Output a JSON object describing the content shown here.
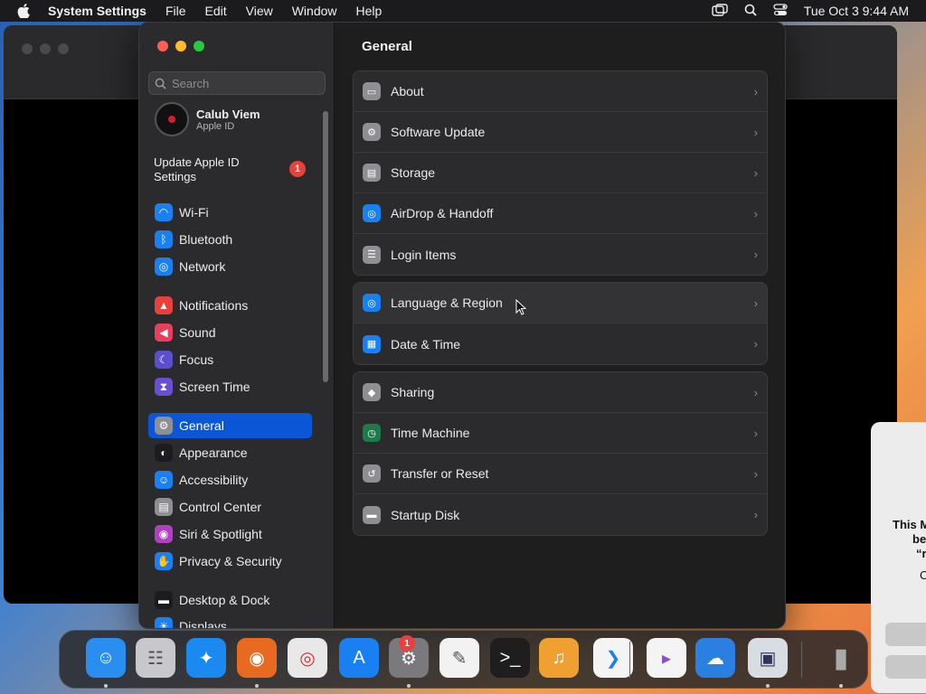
{
  "menubar": {
    "app_name": "System Settings",
    "menus": [
      "File",
      "Edit",
      "View",
      "Window",
      "Help"
    ],
    "datetime": "Tue Oct 3  9:44 AM"
  },
  "sidebar": {
    "search_placeholder": "Search",
    "profile": {
      "name": "Calub Viem",
      "subtitle": "Apple ID"
    },
    "update": {
      "label": "Update Apple ID Settings",
      "badge": "1"
    },
    "items": [
      {
        "label": "Wi-Fi",
        "icon": "wifi-icon",
        "color": "#1a7ff0"
      },
      {
        "label": "Bluetooth",
        "icon": "bluetooth-icon",
        "color": "#1a7ff0"
      },
      {
        "label": "Network",
        "icon": "globe-icon",
        "color": "#1a7ff0"
      },
      {
        "label": "Notifications",
        "icon": "bell-icon",
        "color": "#e8403a"
      },
      {
        "label": "Sound",
        "icon": "speaker-icon",
        "color": "#e8405a"
      },
      {
        "label": "Focus",
        "icon": "moon-icon",
        "color": "#5b4fd0"
      },
      {
        "label": "Screen Time",
        "icon": "hourglass-icon",
        "color": "#6a4fd0"
      },
      {
        "label": "General",
        "icon": "gear-icon",
        "color": "#8e8e93"
      },
      {
        "label": "Appearance",
        "icon": "appearance-icon",
        "color": "#1c1c1e"
      },
      {
        "label": "Accessibility",
        "icon": "accessibility-icon",
        "color": "#1a7ff0"
      },
      {
        "label": "Control Center",
        "icon": "control-center-icon",
        "color": "#8e8e93"
      },
      {
        "label": "Siri & Spotlight",
        "icon": "siri-icon",
        "color": "#b040c0"
      },
      {
        "label": "Privacy & Security",
        "icon": "hand-icon",
        "color": "#1a7ff0"
      },
      {
        "label": "Desktop & Dock",
        "icon": "dock-icon",
        "color": "#1c1c1e"
      },
      {
        "label": "Displays",
        "icon": "display-icon",
        "color": "#1a7ff0"
      }
    ],
    "selected": "General"
  },
  "main": {
    "title": "General",
    "groups": [
      [
        {
          "label": "About",
          "icon": "computer-icon",
          "color": "#8e8e93"
        },
        {
          "label": "Software Update",
          "icon": "gear-badge-icon",
          "color": "#8e8e93"
        },
        {
          "label": "Storage",
          "icon": "storage-icon",
          "color": "#8e8e93"
        },
        {
          "label": "AirDrop & Handoff",
          "icon": "airdrop-icon",
          "color": "#1a7ff0"
        },
        {
          "label": "Login Items",
          "icon": "list-icon",
          "color": "#8e8e93"
        }
      ],
      [
        {
          "label": "Language & Region",
          "icon": "globe-icon",
          "color": "#1a7ff0"
        },
        {
          "label": "Date & Time",
          "icon": "calendar-icon",
          "color": "#1a7ff0"
        }
      ],
      [
        {
          "label": "Sharing",
          "icon": "sharing-icon",
          "color": "#8e8e93"
        },
        {
          "label": "Time Machine",
          "icon": "time-machine-icon",
          "color": "#1f7a4a"
        },
        {
          "label": "Transfer or Reset",
          "icon": "reset-icon",
          "color": "#8e8e93"
        },
        {
          "label": "Startup Disk",
          "icon": "disk-icon",
          "color": "#8e8e93"
        }
      ]
    ]
  },
  "side_dialog": {
    "line1": "This M",
    "line2": "be",
    "line3": "“r",
    "line4": "C"
  },
  "dock": {
    "system_settings_badge": "1",
    "apps": [
      {
        "name": "finder-icon",
        "color": "#2a8ef0"
      },
      {
        "name": "launchpad-icon",
        "color": "#c8c8cc"
      },
      {
        "name": "safari-icon",
        "color": "#1a8af0"
      },
      {
        "name": "firefox-icon",
        "color": "#e86a20"
      },
      {
        "name": "chrome-icon",
        "color": "#e8e8e8"
      },
      {
        "name": "app-store-icon",
        "color": "#1a7ff0"
      },
      {
        "name": "system-settings-icon",
        "color": "#7a7a7e"
      },
      {
        "name": "textedit-icon",
        "color": "#f2f2f2"
      },
      {
        "name": "terminal-icon",
        "color": "#1e1e1e"
      },
      {
        "name": "garageband-icon",
        "color": "#f0a030"
      },
      {
        "name": "vscode-icon",
        "color": "#f4f4f4"
      },
      {
        "name": "visual-studio-icon",
        "color": "#f4f4f4"
      },
      {
        "name": "weather-icon",
        "color": "#2a7fe0"
      },
      {
        "name": "preview-icon",
        "color": "#d8dde4"
      },
      {
        "name": "trash-icon",
        "color": "#6a6a6e"
      }
    ]
  }
}
